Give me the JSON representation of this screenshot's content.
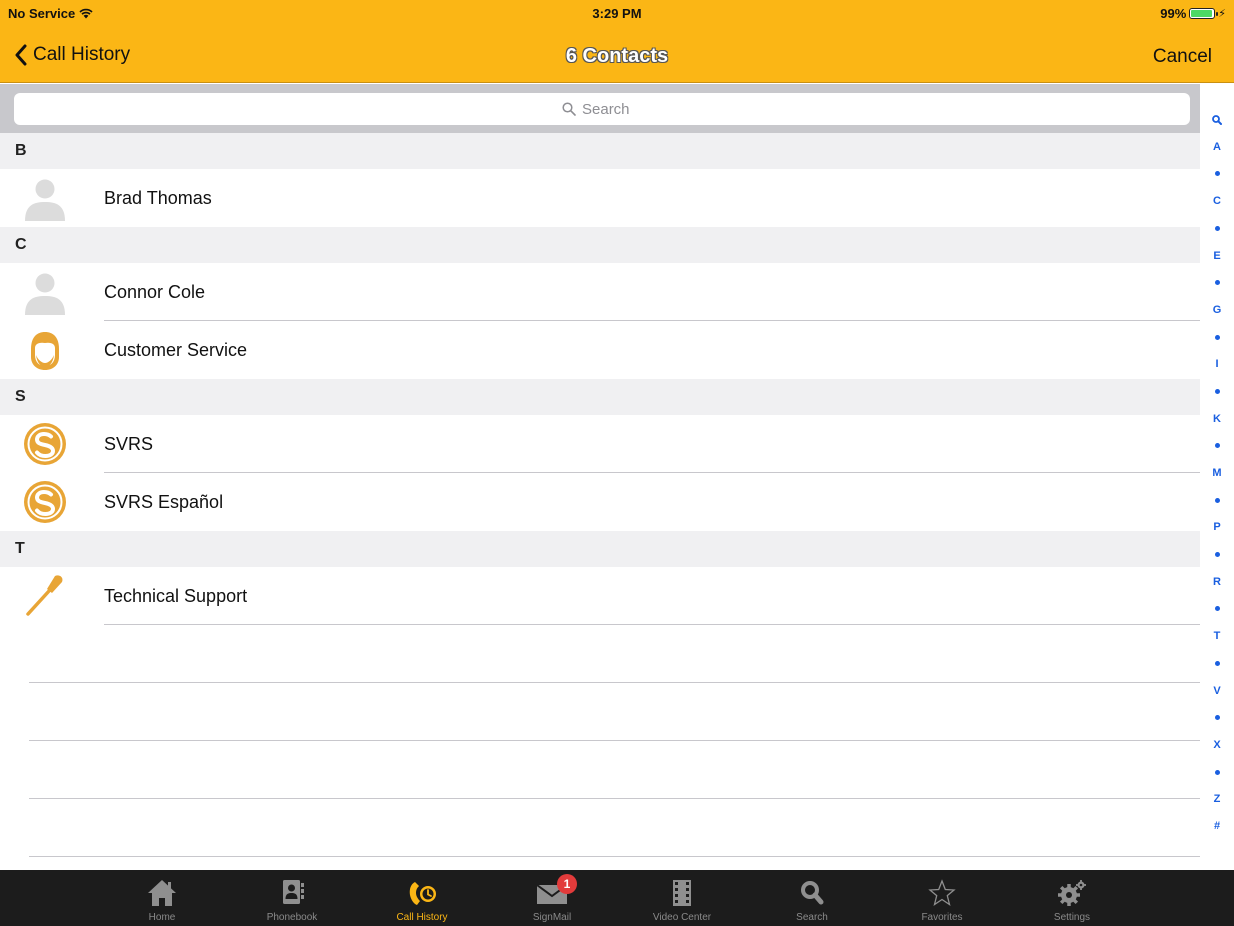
{
  "status_bar": {
    "carrier": "No Service",
    "time": "3:29 PM",
    "battery": "99%"
  },
  "nav": {
    "back_label": "Call History",
    "title": "6 Contacts",
    "cancel_label": "Cancel"
  },
  "search": {
    "placeholder": "Search"
  },
  "sections": [
    {
      "letter": "B",
      "contacts": [
        {
          "name": "Brad Thomas",
          "icon": "person-silhouette-icon"
        }
      ]
    },
    {
      "letter": "C",
      "contacts": [
        {
          "name": "Connor Cole",
          "icon": "person-silhouette-icon"
        },
        {
          "name": "Customer Service",
          "icon": "customer-service-icon"
        }
      ]
    },
    {
      "letter": "S",
      "contacts": [
        {
          "name": "SVRS",
          "icon": "svrs-logo-icon"
        },
        {
          "name": "SVRS Español",
          "icon": "svrs-logo-icon"
        }
      ]
    },
    {
      "letter": "T",
      "contacts": [
        {
          "name": "Technical Support",
          "icon": "screwdriver-icon"
        }
      ]
    }
  ],
  "index": [
    "search",
    "A",
    "•",
    "C",
    "•",
    "E",
    "•",
    "G",
    "•",
    "I",
    "•",
    "K",
    "•",
    "M",
    "•",
    "P",
    "•",
    "R",
    "•",
    "T",
    "•",
    "V",
    "•",
    "X",
    "•",
    "Z",
    "#"
  ],
  "tabs": [
    {
      "label": "Home",
      "icon": "home-icon",
      "active": false
    },
    {
      "label": "Phonebook",
      "icon": "phonebook-icon",
      "active": false
    },
    {
      "label": "Call History",
      "icon": "call-history-icon",
      "active": true
    },
    {
      "label": "SignMail",
      "icon": "signmail-icon",
      "active": false,
      "badge": "1"
    },
    {
      "label": "Video Center",
      "icon": "video-center-icon",
      "active": false
    },
    {
      "label": "Search",
      "icon": "search-icon",
      "active": false
    },
    {
      "label": "Favorites",
      "icon": "star-icon",
      "active": false
    },
    {
      "label": "Settings",
      "icon": "gear-icon",
      "active": false
    }
  ],
  "colors": {
    "header": "#fbb615",
    "accent_blue": "#1a5fe0",
    "tabbar": "#1c1c1c",
    "badge": "#e23b3b"
  }
}
